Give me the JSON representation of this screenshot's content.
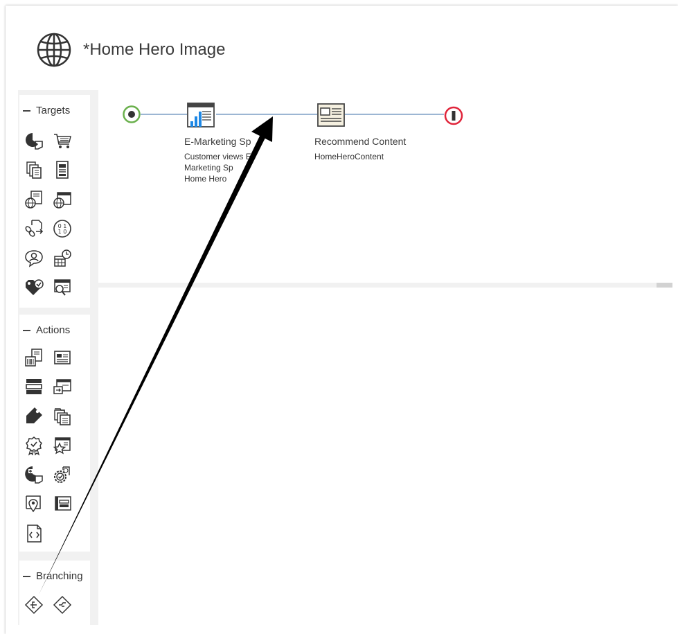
{
  "header": {
    "title": "*Home Hero Image",
    "icon": "globe-icon"
  },
  "palette": {
    "sections": [
      {
        "label": "Targets",
        "tools": [
          "segment-pie-icon",
          "shopping-cart-icon",
          "copy-list-icon",
          "document-list-icon",
          "globe-document-icon",
          "globe-window-icon",
          "link-document-icon",
          "binary-circle-icon",
          "person-chat-icon",
          "calendar-clock-icon",
          "tag-check-icon",
          "search-window-icon"
        ]
      },
      {
        "label": "Actions",
        "tools": [
          "barcode-document-icon",
          "news-card-icon",
          "stacked-bars-icon",
          "window-arrow-icon",
          "tag-icon",
          "stacked-documents-icon",
          "badge-check-icon",
          "star-window-icon",
          "pie-plus-icon",
          "gear-document-icon",
          "map-pin-document-icon",
          "window-list-icon",
          "code-document-icon"
        ]
      },
      {
        "label": "Branching",
        "tools": [
          "diamond-branch-icon",
          "diamond-flow-icon"
        ]
      }
    ]
  },
  "flow": {
    "nodes": [
      {
        "title": "E-Marketing Sp",
        "subtitle": [
          "Customer views E-",
          "Marketing Sp",
          "Home Hero"
        ],
        "icon": "bar-chart-window-icon"
      },
      {
        "title": "Recommend Content",
        "subtitle": [
          "HomeHeroContent"
        ],
        "icon": "news-card-icon"
      }
    ],
    "start_color": "#6ab04c",
    "end_color": "#e0243a",
    "line_color": "#9cb6d3"
  },
  "annotation": {
    "arrow_color": "#000000"
  }
}
